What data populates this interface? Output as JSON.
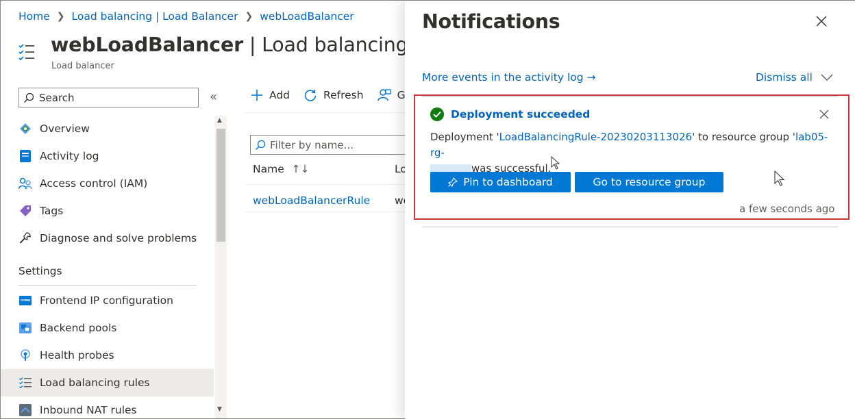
{
  "breadcrumb": {
    "home": "Home",
    "lb_list": "Load balancing | Load Balancer",
    "current": "webLoadBalancer"
  },
  "header": {
    "title_bold": "webLoadBalancer",
    "title_rest": " | Load balancing rule",
    "subtitle": "Load balancer"
  },
  "sidebar": {
    "search_placeholder": "Search",
    "collapse_glyph": "«",
    "items": [
      {
        "label": "Overview",
        "icon": "overview-icon"
      },
      {
        "label": "Activity log",
        "icon": "activity-log-icon"
      },
      {
        "label": "Access control (IAM)",
        "icon": "iam-icon"
      },
      {
        "label": "Tags",
        "icon": "tag-icon"
      },
      {
        "label": "Diagnose and solve problems",
        "icon": "wrench-icon"
      }
    ],
    "settings_label": "Settings",
    "settings_items": [
      {
        "label": "Frontend IP configuration",
        "icon": "frontend-ip-icon"
      },
      {
        "label": "Backend pools",
        "icon": "backend-pools-icon"
      },
      {
        "label": "Health probes",
        "icon": "health-probe-icon"
      },
      {
        "label": "Load balancing rules",
        "icon": "lb-rules-icon",
        "active": true
      },
      {
        "label": "Inbound NAT rules",
        "icon": "nat-rules-icon"
      }
    ]
  },
  "toolbar": {
    "add": "Add",
    "refresh": "Refresh",
    "third_partial": "G"
  },
  "filter": {
    "placeholder": "Filter by name..."
  },
  "table": {
    "columns": [
      "Name",
      "Lo"
    ],
    "rows": [
      {
        "name": "webLoadBalancerRule",
        "col2": "we"
      }
    ]
  },
  "notifications": {
    "title": "Notifications",
    "activity_link": "More events in the activity log →",
    "dismiss_all": "Dismiss all",
    "card": {
      "status": "Deployment succeeded",
      "msg_prefix": "Deployment '",
      "deployment_name": "LoadBalancingRule-20230203113026",
      "msg_mid": "' to resource group '",
      "resource_group": "lab05-rg-",
      "msg_suffix": "was successful.",
      "pin_button": "Pin to dashboard",
      "goto_button": "Go to resource group",
      "time": "a few seconds ago"
    }
  },
  "colors": {
    "link": "#0064bf",
    "primary": "#0078d4",
    "success": "#107c10",
    "highlight": "#d13438"
  }
}
